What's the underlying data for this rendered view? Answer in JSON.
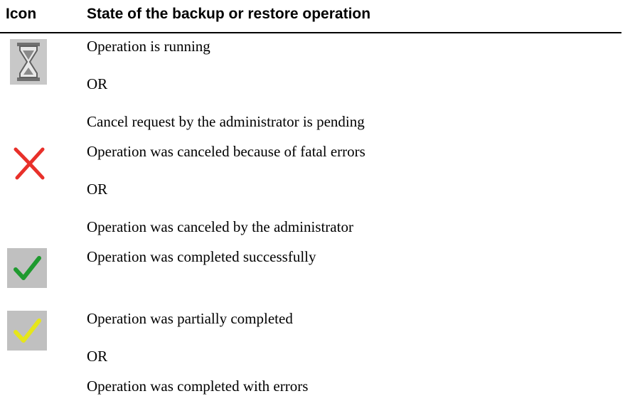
{
  "header": {
    "col_icon": "Icon",
    "col_state": "State of the backup or restore operation"
  },
  "rows": [
    {
      "icon": "hourglass-icon",
      "lines": [
        "Operation is running",
        "OR",
        "Cancel request by the administrator is pending"
      ]
    },
    {
      "icon": "red-x-icon",
      "lines": [
        "Operation was canceled because of fatal errors",
        "OR",
        "Operation was canceled by the administrator"
      ]
    },
    {
      "icon": "green-check-icon",
      "lines": [
        "Operation was completed successfully"
      ]
    },
    {
      "icon": "yellow-check-icon",
      "lines": [
        "Operation was partially completed",
        "OR",
        "Operation was completed with errors"
      ]
    }
  ],
  "colors": {
    "icon_bg": "#c0c0c0",
    "x_red": "#e8302a",
    "check_green": "#1f9a2f",
    "check_yellow": "#e6e61a"
  }
}
